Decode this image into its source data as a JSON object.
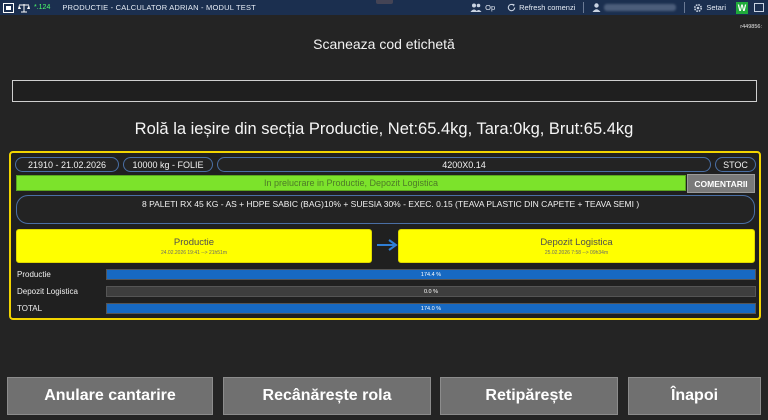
{
  "titlebar": {
    "signal": "*.124",
    "title": "PRODUCTIE - CALCULATOR ADRIAN - MODUL TEST",
    "op_label": "Op",
    "refresh_label": "Refresh comenzi",
    "settings_label": "Setari",
    "brand_letter": "W"
  },
  "build_id": "r449856:",
  "scan": {
    "title": "Scaneaza cod etichetă",
    "input_value": ""
  },
  "roll_title": "Rolă la ieșire din secția Productie, Net:65.4kg, Tara:0kg, Brut:65.4kg",
  "panel": {
    "order_date": "21910 - 21.02.2026",
    "qty_type": "10000 kg - FOLIE",
    "dimensions": "4200X0.14",
    "stock": "STOC",
    "status": "In prelucrare in Productie, Depozit Logistica",
    "comments_label": "COMENTARII",
    "description": "8 PALETI RX 45 KG  -  AS + HDPE SABIC (BAG)10% + SUESIA 30%  -  EXEC.  0.15   (TEAVA PLASTIC DIN CAPETE + TEAVA SEMI )",
    "stages": [
      {
        "name": "Productie",
        "time": "24.02.2026 19:41 --> 21h51m"
      },
      {
        "name": "Depozit Logistica",
        "time": "25.02.2026 7:58 --> 09h34m"
      }
    ],
    "progress": [
      {
        "label": "Productie",
        "value_text": "174.4 %",
        "fill_fraction": 1.0
      },
      {
        "label": "Depozit Logistica",
        "value_text": "0.0 %",
        "fill_fraction": 0.0
      },
      {
        "label": "TOTAL",
        "value_text": "174.0 %",
        "fill_fraction": 1.0
      }
    ]
  },
  "buttons": {
    "cancel": "Anulare cantarire",
    "reweigh": "Recânărește rola",
    "reprint": "Retipărește",
    "back": "Înapoi"
  },
  "colors": {
    "titlebar": "#1b2f4f",
    "panel_border": "#f2d400",
    "status_green": "#7ce32b",
    "stage_yellow": "#ffff00",
    "progress_blue": "#1769c2",
    "button_grey": "#707070"
  }
}
